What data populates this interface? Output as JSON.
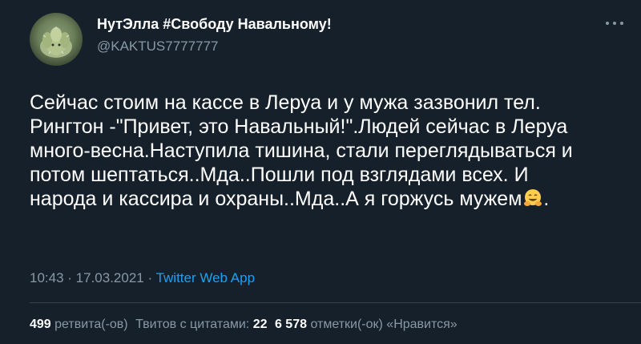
{
  "author": {
    "display_name": "НутЭлла #Свободу Навальному!",
    "handle": "@KAKTUS7777777",
    "avatar_icon": "cactus-avatar-icon"
  },
  "menu_icon": "more-options-icon",
  "tweet": {
    "lines": [
      "Сейчас  стоим на кассе в Леруа и у мужа зазвонил тел.",
      "Рингтон -\"Привет, это Навальный!\".Людей сейчас в Леруа",
      "много-весна.Наступила тишина, стали переглядываться и",
      "потом шептаться..Мда..Пошли под взглядами всех. И",
      "народа и кассира и охраны..Мда..А я горжусь мужем"
    ],
    "emoji": "hugging-face-icon",
    "trailing": "."
  },
  "meta": {
    "time": "10:43",
    "separator": " · ",
    "date": "17.03.2021",
    "separator2": " · ",
    "source": "Twitter Web App"
  },
  "stats": {
    "retweets_count": "499",
    "retweets_label": "ретвита(-ов)",
    "quotes_label": "Твитов с цитатами:",
    "quotes_count": "22",
    "likes_count": "6 578",
    "likes_label": "отметки(-ок) «Нравится»"
  },
  "colors": {
    "background": "#15202b",
    "text": "#ffffff",
    "secondary": "#8899a6",
    "link": "#1da1f2",
    "divider": "#38444d"
  }
}
